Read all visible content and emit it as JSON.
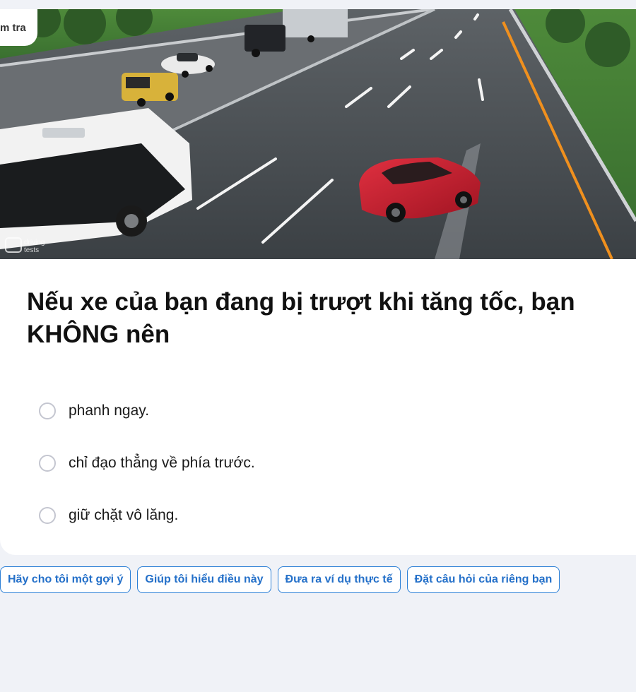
{
  "header": {
    "mode_label": "m tra"
  },
  "scene": {
    "description_icon": "road-scene-image",
    "watermark_line1": "driving",
    "watermark_line2": "tests"
  },
  "question": {
    "text": "Nếu xe của bạn đang bị trượt khi tăng tốc, bạn KHÔNG nên"
  },
  "answers": [
    {
      "label": "phanh ngay."
    },
    {
      "label": "chỉ đạo thẳng về phía trước."
    },
    {
      "label": "giữ chặt vô lăng."
    }
  ],
  "chips": [
    {
      "label": "Hãy cho tôi một gợi ý"
    },
    {
      "label": "Giúp tôi hiểu điều này"
    },
    {
      "label": "Đưa ra ví dụ thực tế"
    },
    {
      "label": "Đặt câu hỏi của riêng bạn"
    }
  ],
  "colors": {
    "accent": "#2470c9",
    "background": "#f0f2f7",
    "car_red": "#c8202e"
  }
}
